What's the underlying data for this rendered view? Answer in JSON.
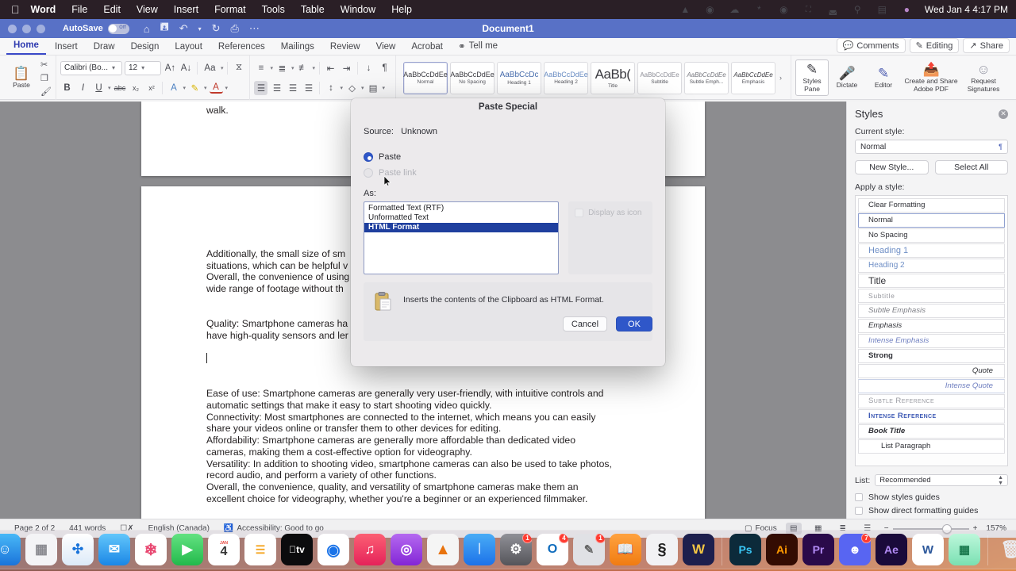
{
  "macos_menubar": {
    "apple_icon": "apple-icon",
    "items": [
      "Word",
      "File",
      "Edit",
      "View",
      "Insert",
      "Format",
      "Tools",
      "Table",
      "Window",
      "Help"
    ],
    "status_icons": [
      "vlc-icon",
      "grammarly-icon",
      "creative-cloud-icon",
      "bluetooth-icon",
      "timemachine-icon",
      "battery-icon",
      "wifi-icon",
      "spotlight-search-icon",
      "control-center-icon",
      "siri-icon"
    ],
    "clock": "Wed Jan 4  4:17 PM"
  },
  "window": {
    "title": "Document1",
    "autosave_label": "AutoSave",
    "autosave_state": "Off",
    "quick_access": [
      "home-icon",
      "save-icon",
      "undo-icon",
      "undo-dropdown-icon",
      "redo-icon",
      "print-icon",
      "more-icon"
    ]
  },
  "ribbon": {
    "tabs": [
      "Home",
      "Insert",
      "Draw",
      "Design",
      "Layout",
      "References",
      "Mailings",
      "Review",
      "View",
      "Acrobat"
    ],
    "active_tab": "Home",
    "tell_me": "Tell me",
    "right_buttons": [
      {
        "label": "Comments",
        "icon": "comment-icon"
      },
      {
        "label": "Editing",
        "icon": "pencil-icon"
      },
      {
        "label": "Share",
        "icon": "share-icon"
      }
    ],
    "clipboard": {
      "paste_label": "Paste",
      "paste_icon": "paste-icon",
      "cut_icon": "scissors-icon",
      "copy_icon": "copy-icon",
      "format_painter_icon": "format-painter-icon"
    },
    "font": {
      "font_name": "Calibri (Bo...",
      "font_size": "12",
      "grow_icon": "grow-font-icon",
      "shrink_icon": "shrink-font-icon",
      "change_case_icon": "change-case-icon",
      "clear_formatting_icon": "clear-formatting-icon",
      "bold": "B",
      "italic": "I",
      "underline": "U",
      "strikethrough": "abc",
      "subscript": "x₂",
      "superscript": "x²",
      "text_effects_icon": "text-effects-icon",
      "highlight_icon": "highlight-icon",
      "font_color_icon": "font-color-icon"
    },
    "paragraph": {
      "bullets_icon": "bullets-icon",
      "numbering_icon": "numbering-icon",
      "multilevel_icon": "multilevel-list-icon",
      "decrease_indent_icon": "decrease-indent-icon",
      "increase_indent_icon": "increase-indent-icon",
      "sort_icon": "sort-icon",
      "show_marks_icon": "show-formatting-marks-icon",
      "align_left_icon": "align-left-icon",
      "align_center_icon": "align-center-icon",
      "align_right_icon": "align-right-icon",
      "justify_icon": "justify-icon",
      "line_spacing_icon": "line-spacing-icon",
      "shading_icon": "shading-icon",
      "borders_icon": "borders-icon"
    },
    "styles_gallery": [
      {
        "sample": "AaBbCcDdEe",
        "name": "Normal",
        "selected": true
      },
      {
        "sample": "AaBbCcDdEe",
        "name": "No Spacing",
        "selected": false
      },
      {
        "sample": "AaBbCcDc",
        "name": "Heading 1",
        "selected": false
      },
      {
        "sample": "AaBbCcDdEe",
        "name": "Heading 2",
        "selected": false
      },
      {
        "sample": "AaBb(",
        "name": "Title",
        "selected": false
      },
      {
        "sample": "AaBbCcDdEe",
        "name": "Subtitle",
        "selected": false
      },
      {
        "sample": "AaBbCcDdEe",
        "name": "Subtle Emph...",
        "selected": false
      },
      {
        "sample": "AaBbCcDdEe",
        "name": "Emphasis",
        "selected": false
      }
    ],
    "gallery_more": "›",
    "right_commands": [
      {
        "label": "Styles\nPane",
        "line1": "Styles",
        "line2": "Pane",
        "icon": "styles-pane-icon"
      },
      {
        "label": "Dictate",
        "line1": "Dictate",
        "line2": "",
        "icon": "microphone-icon"
      },
      {
        "label": "Editor",
        "line1": "Editor",
        "line2": "",
        "icon": "editor-icon"
      },
      {
        "label": "Create and Share Adobe PDF",
        "line1": "Create and Share",
        "line2": "Adobe PDF",
        "icon": "adobe-pdf-icon"
      },
      {
        "label": "Request Signatures",
        "line1": "Request",
        "line2": "Signatures",
        "icon": "signature-icon"
      }
    ]
  },
  "document": {
    "page1_text": "walk.",
    "paragraphs_block1": [
      "Additionally, the small size of sm",
      "situations, which can be helpful v",
      "Overall, the convenience of using",
      "wide range of footage without th"
    ],
    "paragraphs_block2": [
      "Quality: Smartphone cameras ha",
      "have high-quality sensors and ler"
    ],
    "paragraphs_block3": [
      "Ease of use: Smartphone cameras are generally very user-friendly, with intuitive controls and",
      "automatic settings that make it easy to start shooting video quickly.",
      "Connectivity: Most smartphones are connected to the internet, which means you can easily",
      "share your videos online or transfer them to other devices for editing.",
      "Affordability: Smartphone cameras are generally more affordable than dedicated video",
      "cameras, making them a cost-effective option for videography.",
      "Versatility: In addition to shooting video, smartphone cameras can also be used to take photos,",
      "record audio, and perform a variety of other functions.",
      "Overall, the convenience, quality, and versatility of smartphone cameras make them an",
      "excellent choice for videography, whether you're a beginner or an experienced filmmaker."
    ]
  },
  "styles_pane": {
    "title": "Styles",
    "close_icon": "close-icon",
    "current_style_label": "Current style:",
    "current_style_value": "Normal",
    "new_style_button": "New Style...",
    "select_all_button": "Select All",
    "apply_style_label": "Apply a style:",
    "styles": [
      {
        "label": "Clear Formatting",
        "variant": "plain"
      },
      {
        "label": "Normal",
        "variant": "selected"
      },
      {
        "label": "No Spacing",
        "variant": "plain"
      },
      {
        "label": "Heading 1",
        "variant": "h1"
      },
      {
        "label": "Heading 2",
        "variant": "h2"
      },
      {
        "label": "Title",
        "variant": "title"
      },
      {
        "label": "Subtitle",
        "variant": "subtitle"
      },
      {
        "label": "Subtle Emphasis",
        "variant": "subtle-emph"
      },
      {
        "label": "Emphasis",
        "variant": "emph"
      },
      {
        "label": "Intense Emphasis",
        "variant": "intense-emph"
      },
      {
        "label": "Strong",
        "variant": "strong"
      },
      {
        "label": "Quote",
        "variant": "quote"
      },
      {
        "label": "Intense Quote",
        "variant": "intense-quote"
      },
      {
        "label": "Subtle Reference",
        "variant": "subtle-ref"
      },
      {
        "label": "Intense Reference",
        "variant": "intense-ref"
      },
      {
        "label": "Book Title",
        "variant": "book-title"
      },
      {
        "label": "List Paragraph",
        "variant": "list-para"
      }
    ],
    "list_label": "List:",
    "list_value": "Recommended",
    "show_styles_guides": "Show styles guides",
    "show_direct_formatting_guides": "Show direct formatting guides"
  },
  "dialog": {
    "title": "Paste Special",
    "source_label": "Source:",
    "source_value": "Unknown",
    "paste_label": "Paste",
    "paste_link_label": "Paste link",
    "as_label": "As:",
    "options": [
      {
        "label": "Formatted Text (RTF)",
        "selected": false
      },
      {
        "label": "Unformatted Text",
        "selected": false
      },
      {
        "label": "HTML Format",
        "selected": true
      }
    ],
    "display_as_icon_label": "Display as icon",
    "description": "Inserts the contents of the Clipboard as HTML Format.",
    "description_icon": "clipboard-icon",
    "cancel_button": "Cancel",
    "ok_button": "OK",
    "accent_color": "#2f57c9",
    "selection_color": "#1f3f9e"
  },
  "status_bar": {
    "page": "Page 2 of 2",
    "words": "441 words",
    "proofing_icon": "proofing-icon",
    "language": "English (Canada)",
    "accessibility_icon": "accessibility-icon",
    "accessibility": "Accessibility: Good to go",
    "focus_label": "Focus",
    "focus_icon": "focus-icon",
    "view_buttons": [
      "print-layout-icon",
      "web-layout-icon",
      "outline-icon",
      "draft-icon"
    ],
    "zoom_out": "−",
    "zoom_in": "+",
    "zoom": "157%"
  },
  "dock": {
    "apps": [
      {
        "name": "finder",
        "glyph": "☺",
        "bg": "linear-gradient(180deg,#38b0f5,#1f7fe0)",
        "color": "#fff",
        "running": true,
        "badge": ""
      },
      {
        "name": "launchpad",
        "glyph": "▦",
        "bg": "#f3f3f5",
        "color": "#777",
        "running": false,
        "badge": ""
      },
      {
        "name": "safari",
        "glyph": "🧭",
        "bg": "linear-gradient(180deg,#ffffff,#e4eef8)",
        "color": "#1f7fe0",
        "running": true,
        "badge": ""
      },
      {
        "name": "mail",
        "glyph": "✉",
        "bg": "linear-gradient(180deg,#5fc4fb,#1e8ae8)",
        "color": "#fff",
        "running": false,
        "badge": ""
      },
      {
        "name": "photos",
        "glyph": "❀",
        "bg": "#ffffff",
        "color": "#e8456f",
        "running": false,
        "badge": ""
      },
      {
        "name": "facetime",
        "glyph": "▶",
        "bg": "linear-gradient(180deg,#5ee07a,#21b84a)",
        "color": "#fff",
        "running": false,
        "badge": ""
      },
      {
        "name": "calendar",
        "glyph": "4",
        "bg": "#ffffff",
        "color": "#333",
        "running": false,
        "badge": ""
      },
      {
        "name": "reminders",
        "glyph": "☰",
        "bg": "#ffffff",
        "color": "#f5a623",
        "running": false,
        "badge": ""
      },
      {
        "name": "apple-tv",
        "glyph": "tv",
        "bg": "#0b0b0d",
        "color": "#fff",
        "running": false,
        "badge": ""
      },
      {
        "name": "chrome",
        "glyph": "◉",
        "bg": "#ffffff",
        "color": "#1a73e8",
        "running": true,
        "badge": ""
      },
      {
        "name": "music",
        "glyph": "♪",
        "bg": "linear-gradient(180deg,#fb5f72,#e8245a)",
        "color": "#fff",
        "running": false,
        "badge": ""
      },
      {
        "name": "podcasts",
        "glyph": "◉",
        "bg": "linear-gradient(180deg,#b martial,#8a2be2)",
        "color": "#fff",
        "running": false,
        "badge": ""
      },
      {
        "name": "vlc",
        "glyph": "▲",
        "bg": "#f4f4f4",
        "color": "#e8730d",
        "running": true,
        "badge": ""
      },
      {
        "name": "app-store",
        "glyph": "Ⓐ",
        "bg": "linear-gradient(180deg,#46a7f5,#1b72e8)",
        "color": "#fff",
        "running": false,
        "badge": ""
      },
      {
        "name": "system-settings",
        "glyph": "⚙",
        "bg": "linear-gradient(180deg,#8d8d93,#58585d)",
        "color": "#fff",
        "running": true,
        "badge": "1"
      },
      {
        "name": "outlook",
        "glyph": "O",
        "bg": "#ffffff",
        "color": "#0f6cbd",
        "running": true,
        "badge": "4"
      },
      {
        "name": "stickies",
        "glyph": "✎",
        "bg": "#dfe0e4",
        "color": "#555",
        "running": false,
        "badge": "1"
      },
      {
        "name": "books",
        "glyph": "◫",
        "bg": "linear-gradient(180deg,#ff9f3a,#f07c12)",
        "color": "#fff",
        "running": false,
        "badge": ""
      },
      {
        "name": "sketch",
        "glyph": "§",
        "bg": "#f1f1f3",
        "color": "#222",
        "running": false,
        "badge": ""
      },
      {
        "name": "wondershare",
        "glyph": "W",
        "bg": "#1d1f4d",
        "color": "#f2c544",
        "running": false,
        "badge": ""
      },
      {
        "name": "photoshop",
        "glyph": "Ps",
        "bg": "#0c2a3a",
        "color": "#39c5f3",
        "running": true,
        "badge": ""
      },
      {
        "name": "illustrator",
        "glyph": "Ai",
        "bg": "#330c02",
        "color": "#ff9a00",
        "running": true,
        "badge": ""
      },
      {
        "name": "premiere-pro",
        "glyph": "Pr",
        "bg": "#2a0a4a",
        "color": "#b28bf5",
        "running": true,
        "badge": ""
      },
      {
        "name": "discord",
        "glyph": "☻",
        "bg": "#5865f2",
        "color": "#fff",
        "running": true,
        "badge": "7"
      },
      {
        "name": "after-effects",
        "glyph": "Ae",
        "bg": "#1a0a3a",
        "color": "#b28bf5",
        "running": true,
        "badge": ""
      },
      {
        "name": "word",
        "glyph": "W",
        "bg": "#ffffff",
        "color": "#2b579a",
        "running": true,
        "badge": ""
      },
      {
        "name": "monosnap",
        "glyph": "▥",
        "bg": "linear-gradient(180deg,#b9f5d8,#7ae0b2)",
        "color": "#1b7a4f",
        "running": true,
        "badge": ""
      },
      {
        "name": "trash",
        "glyph": "🗑",
        "bg": "transparent",
        "color": "#e8e8ea",
        "running": false,
        "badge": ""
      }
    ]
  }
}
